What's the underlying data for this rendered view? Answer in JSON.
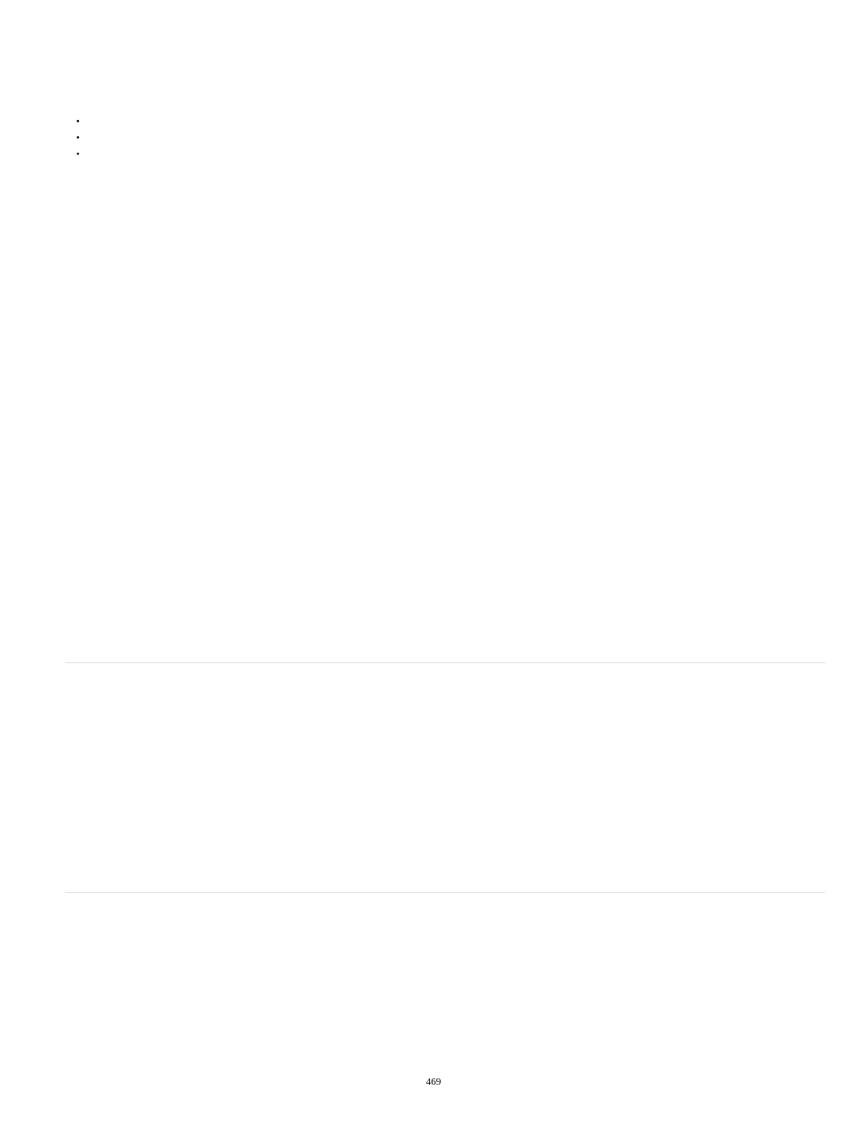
{
  "bullets": {
    "item0": "",
    "item1": "",
    "item2": "",
    "item3": "",
    "item4": ""
  },
  "page_number": "469"
}
